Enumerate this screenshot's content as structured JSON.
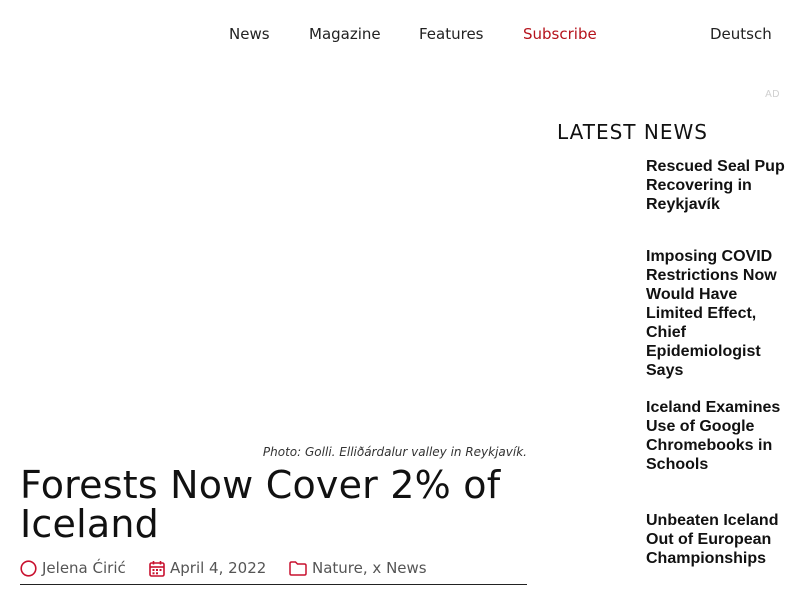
{
  "nav": {
    "items": [
      "News",
      "Magazine",
      "Features",
      "Subscribe"
    ],
    "language": "Deutsch"
  },
  "ad_label": "AD",
  "article": {
    "photo_caption": "Photo: Golli. Elliðárdalur valley in Reykjavík.",
    "title": "Forests Now Cover 2% of Iceland",
    "author": "Jelena Ćirić",
    "date": "April 4, 2022",
    "categories": [
      "Nature",
      "x News"
    ],
    "category_separator": ", "
  },
  "sidebar": {
    "heading": "LATEST NEWS",
    "items": [
      {
        "title": "Rescued Seal Pup Recovering in Reykjavík"
      },
      {
        "title": "Imposing COVID Restrictions Now Would Have Limited Effect, Chief Epidemiologist Says"
      },
      {
        "title": "Iceland Examines Use of Google Chromebooks in Schools"
      },
      {
        "title": "Unbeaten Iceland Out of European Championships"
      }
    ]
  },
  "colors": {
    "accent": "#b5121b",
    "text": "#111111",
    "meta_text": "#555555"
  },
  "icons": {
    "author": "user-circle-icon",
    "date": "calendar-icon",
    "category": "folder-icon"
  }
}
